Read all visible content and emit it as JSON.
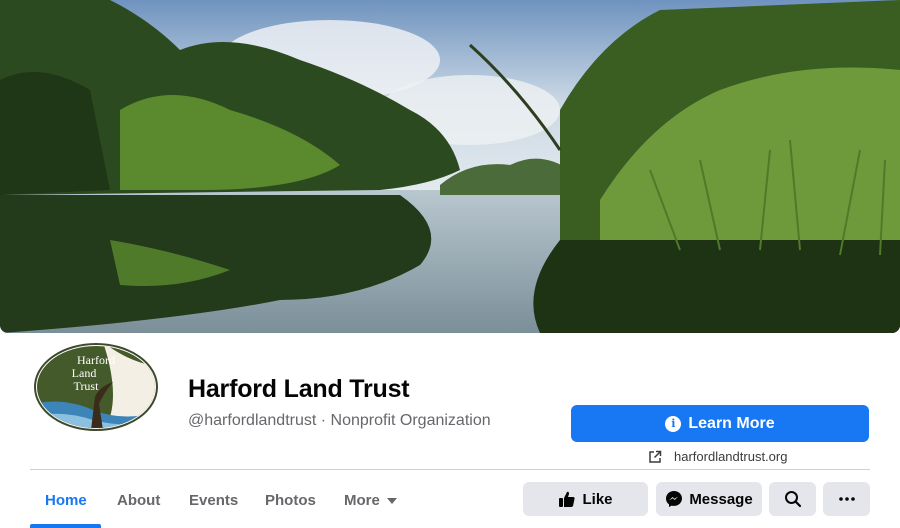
{
  "cover": {
    "scene": "river-landscape"
  },
  "profile": {
    "logo_line1": "Harford",
    "logo_line2": "Land",
    "logo_line3": "Trust",
    "name": "Harford Land Trust",
    "handle_category": "@harfordlandtrust · Nonprofit Organization"
  },
  "cta": {
    "learn_more": "Learn More",
    "website": "harfordlandtrust.org",
    "icon_info": "info-icon",
    "icon_link": "external-link-icon"
  },
  "tabs": [
    {
      "label": "Home",
      "active": true
    },
    {
      "label": "About"
    },
    {
      "label": "Events"
    },
    {
      "label": "Photos"
    },
    {
      "label": "More"
    }
  ],
  "actions": {
    "like": "Like",
    "message": "Message",
    "search_icon": "search-icon",
    "more_icon": "more-icon"
  },
  "colors": {
    "accent": "#1877f2",
    "button_gray": "#e4e6eb",
    "secondary_text": "#65676b"
  }
}
